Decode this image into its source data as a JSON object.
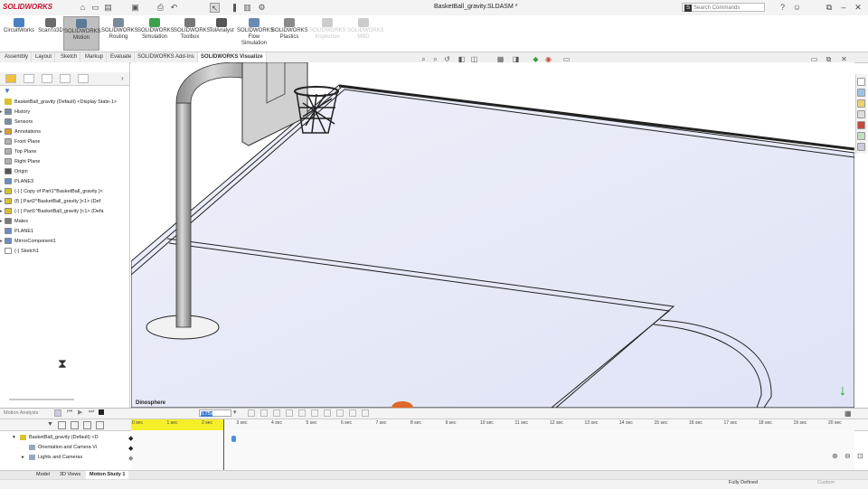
{
  "app": {
    "logo_text": "SOLIDWORKS",
    "doc_title": "BasketBall_gravity.SLDASM *"
  },
  "search": {
    "placeholder": "Search Commands"
  },
  "ribbon": {
    "buttons": [
      {
        "label": "CircuitWorks",
        "icon": "circuit-icon",
        "color": "#4a7fc1"
      },
      {
        "label": "ScanTo3D",
        "icon": "scan-icon",
        "color": "#6a6a6a"
      },
      {
        "label": "SOLIDWORKS\nMotion",
        "icon": "motion-icon",
        "color": "#5a7a9a",
        "active": true
      },
      {
        "label": "SOLIDWORKS\nRouting",
        "icon": "routing-icon",
        "color": "#7a8a9a"
      },
      {
        "label": "SOLIDWORKS\nSimulation",
        "icon": "simulation-icon",
        "color": "#3da14a"
      },
      {
        "label": "SOLIDWORKS\nToolbox",
        "icon": "toolbox-icon",
        "color": "#777777"
      },
      {
        "label": "TolAnalyst",
        "icon": "tolanalyst-icon",
        "color": "#555555"
      },
      {
        "label": "SOLIDWORKS\nFlow\nSimulation",
        "icon": "flow-icon",
        "color": "#6a8ab0"
      },
      {
        "label": "SOLIDWORKS\nPlastics",
        "icon": "plastics-icon",
        "color": "#8a8a8a"
      },
      {
        "label": "SOLIDWORKS\nInspection",
        "icon": "inspection-icon",
        "color": "#cccccc",
        "disabled": true
      },
      {
        "label": "SOLIDWORKS\nMBD",
        "icon": "mbd-icon",
        "color": "#cccccc",
        "disabled": true
      }
    ]
  },
  "command_tabs": [
    "Assembly",
    "Layout",
    "Sketch",
    "Markup",
    "Evaluate",
    "SOLIDWORKS Add-Ins",
    "SOLIDWORKS Visualize"
  ],
  "command_tabs_active": 6,
  "tree": {
    "root": "BasketBall_gravity (Default) <Display State-1>",
    "items": [
      {
        "label": "History",
        "icon": "history-icon",
        "color": "#7a8fa6",
        "expand": "▸"
      },
      {
        "label": "Sensors",
        "icon": "sensor-icon",
        "color": "#7a8fa6",
        "expand": ""
      },
      {
        "label": "Annotations",
        "icon": "annotation-icon",
        "color": "#d9a02b",
        "expand": "▸"
      },
      {
        "label": "Front Plane",
        "icon": "plane-icon",
        "color": "#b0b0b0",
        "expand": ""
      },
      {
        "label": "Top Plane",
        "icon": "plane-icon",
        "color": "#b0b0b0",
        "expand": ""
      },
      {
        "label": "Right Plane",
        "icon": "plane-icon",
        "color": "#b0b0b0",
        "expand": ""
      },
      {
        "label": "Origin",
        "icon": "origin-icon",
        "color": "#555555",
        "expand": ""
      },
      {
        "label": "PLANE3",
        "icon": "plane-icon",
        "color": "#6a8ec4",
        "expand": ""
      },
      {
        "label": "(-) [ Copy of Part1^BasketBall_gravity ]<",
        "icon": "part-icon",
        "color": "#d9c22b",
        "expand": "▸"
      },
      {
        "label": "(f) [ Part2^BasketBall_gravity ]<1> (Def",
        "icon": "part-icon",
        "color": "#d9c22b",
        "expand": "▸"
      },
      {
        "label": "(-) [ Part1^BasketBall_gravity ]<1> (Defa",
        "icon": "part-icon",
        "color": "#d9c22b",
        "expand": "▸"
      },
      {
        "label": "Mates",
        "icon": "mates-icon",
        "color": "#7a7a7a",
        "expand": "▸"
      },
      {
        "label": "PLANE1",
        "icon": "plane-icon",
        "color": "#6a8ec4",
        "expand": ""
      },
      {
        "label": "MirrorComponent1",
        "icon": "mirror-icon",
        "color": "#6a8ec4",
        "expand": "▸"
      },
      {
        "label": "(-) Sketch1",
        "icon": "sketch-icon",
        "color": "#ffffff",
        "expand": ""
      }
    ]
  },
  "viewport": {
    "hint_text": "Dinosphere"
  },
  "motion": {
    "study_type": "Motion Analysis",
    "time_value": "0.75s",
    "ticks": [
      "0 sec",
      "1 sec",
      "2 sec",
      "3 sec",
      "4 sec",
      "5 sec",
      "6 sec",
      "7 sec",
      "8 sec",
      "9 sec",
      "10 sec",
      "11 sec",
      "12 sec",
      "13 sec",
      "14 sec",
      "15 sec",
      "16 sec",
      "17 sec",
      "18 sec",
      "19 sec",
      "20 sec"
    ],
    "rows": [
      {
        "label": "BasketBall_gravity (Default) <D",
        "expand": "▾"
      },
      {
        "label": "Orientation and Camera Vi",
        "expand": ""
      },
      {
        "label": "Lights and Cameras",
        "expand": "▸"
      }
    ]
  },
  "bottom_tabs": [
    "Model",
    "3D Views",
    "Motion Study 1"
  ],
  "bottom_tabs_active": 2,
  "status": {
    "state": "Fully Defined",
    "custom": "Custom"
  }
}
